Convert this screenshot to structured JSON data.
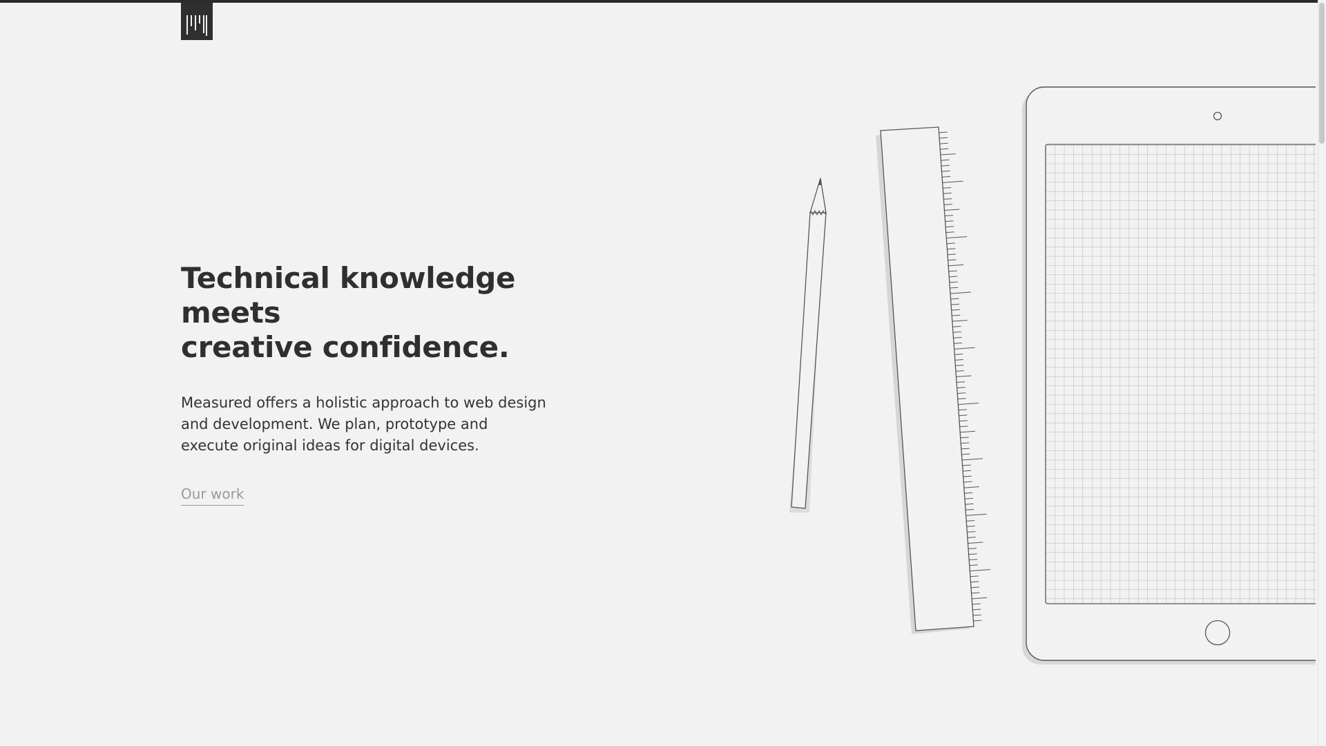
{
  "brand": {
    "logo_icon": "measured-logo-icon"
  },
  "hero": {
    "title_line1": "Technical knowledge meets",
    "title_line2": "creative confidence.",
    "body": "Measured offers a holistic approach to web design and development. We plan, prototype and execute original ideas for digital devices.",
    "cta_label": "Our work"
  },
  "illustration": {
    "items": [
      "pencil-icon",
      "ruler-icon",
      "tablet-icon"
    ]
  },
  "colors": {
    "background": "#f2f2f2",
    "text": "#2f2f2f",
    "muted": "#9a9a9a",
    "line": "#555555"
  }
}
